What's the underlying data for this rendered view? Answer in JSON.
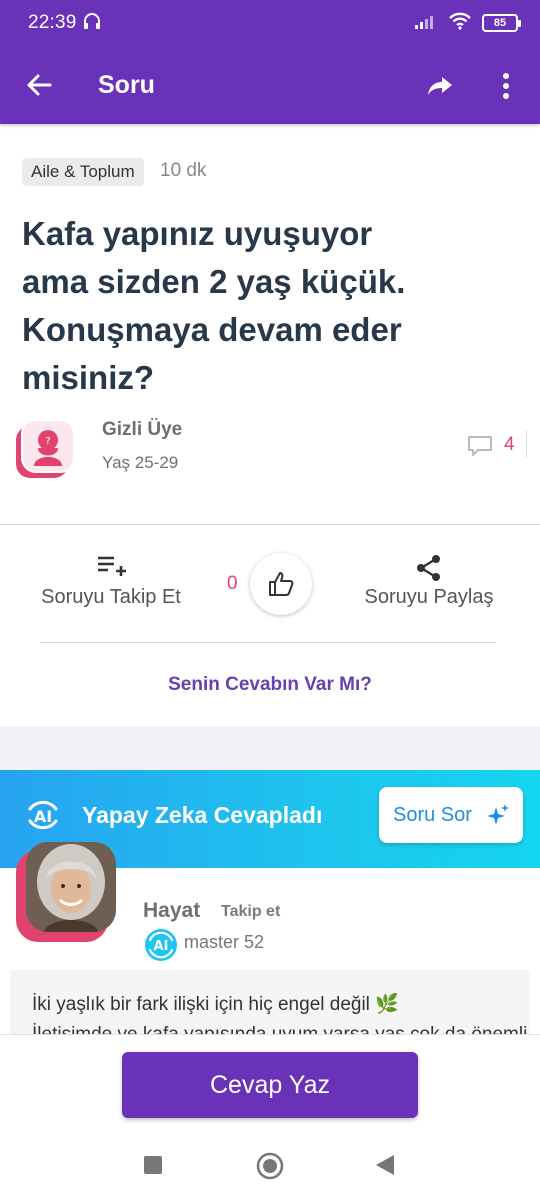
{
  "status_bar": {
    "time": "22:39",
    "battery": "85"
  },
  "app_bar": {
    "title": "Soru"
  },
  "question": {
    "category": "Aile & Toplum",
    "time_ago": "10 dk",
    "title": "Kafa yapınız uyuşuyor ama sizden 2 yaş küçük. Konuşmaya devam eder misiniz?",
    "author": {
      "name": "Gizli Üye",
      "age": "Yaş 25-29"
    },
    "comment_count": "4"
  },
  "actions": {
    "follow_label": "Soruyu Takip Et",
    "like_count": "0",
    "share_label": "Soruyu Paylaş",
    "your_answer": "Senin Cevabın Var Mı?"
  },
  "ai_banner": {
    "title": "Yapay Zeka Cevapladı",
    "ask_button": "Soru Sor"
  },
  "answer": {
    "name": "Hayat",
    "follow": "Takip et",
    "level": "master 52",
    "text_line1": "İki yaşlık bir fark ilişki için hiç engel değil 🌿",
    "text_line2": "İletişimde ve kafa yapısında uyum varsa yaş çok da önemli değil"
  },
  "bottom": {
    "answer_button": "Cevap Yaz"
  },
  "colors": {
    "primary": "#6a32b8",
    "accent_pink": "#e0436f",
    "ai_blue": "#1ec5ee",
    "title_text": "#27384b"
  }
}
